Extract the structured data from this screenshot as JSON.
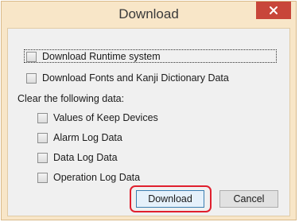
{
  "window": {
    "title": "Download",
    "close_glyph": "×"
  },
  "options": {
    "download_runtime": "Download Runtime system",
    "download_fonts": "Download Fonts and Kanji Dictionary Data",
    "clear_label": "Clear the following data:",
    "keep_devices": "Values of Keep Devices",
    "alarm_log": "Alarm Log Data",
    "data_log": "Data Log Data",
    "operation_log": "Operation Log Data"
  },
  "buttons": {
    "download": "Download",
    "cancel": "Cancel"
  },
  "colors": {
    "window_frame": "#f8e6c8",
    "close_button": "#c8463a",
    "highlight": "#e0202e"
  },
  "icons": {
    "close": "close-icon",
    "checkbox": "checkbox-unchecked-icon"
  }
}
